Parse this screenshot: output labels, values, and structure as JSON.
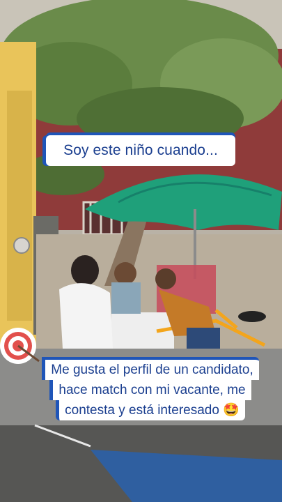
{
  "captions": {
    "top": "Soy este niño cuando...",
    "bottom_lines": [
      "Me gusta el perfil de un candidato,",
      "hace match con mi vacante, me",
      "contesta y está interesado 🤩"
    ]
  },
  "icons": {
    "target": "target-dart-icon"
  },
  "colors": {
    "caption_text": "#1a3e8f",
    "caption_accent": "#1f55b8",
    "umbrella": "#1fa07a",
    "wall": "#e9c45a",
    "cart": "#f3a51c"
  }
}
